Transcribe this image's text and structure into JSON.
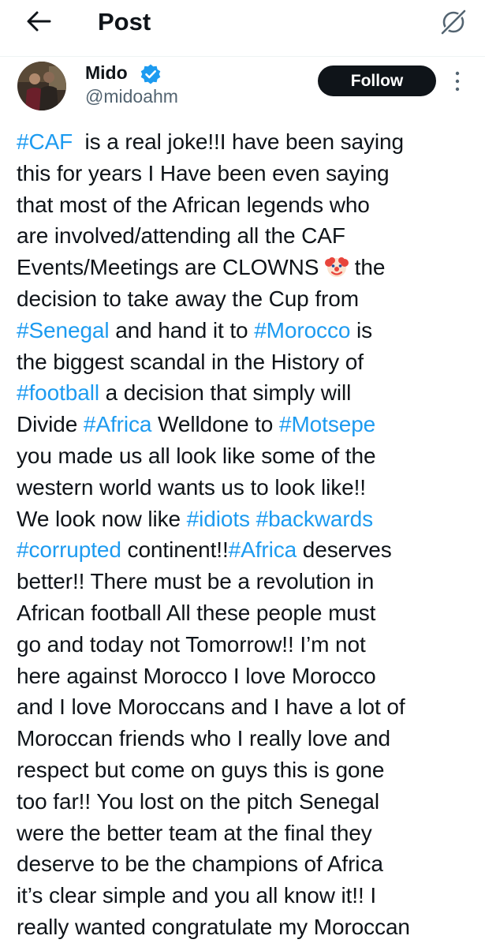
{
  "header": {
    "title": "Post",
    "back_icon": "arrow-left-icon",
    "grok_icon": "grok-icon"
  },
  "author": {
    "display_name": "Mido",
    "handle": "@midoahm",
    "verified": true,
    "verified_color": "#1d9bf0",
    "follow_label": "Follow"
  },
  "colors": {
    "hashtag": "#1d9bf0",
    "text": "#0f1419",
    "secondary": "#536471"
  },
  "post": {
    "emoji": "clown-face",
    "lines": [
      [
        {
          "t": "#CAF",
          "tag": true
        },
        {
          "t": "  is a real joke!!I have been saying"
        }
      ],
      [
        {
          "t": "this for years I Have been even saying"
        }
      ],
      [
        {
          "t": "that most of the African legends who"
        }
      ],
      [
        {
          "t": "are involved/attending all the CAF"
        }
      ],
      [
        {
          "t": "Events/Meetings are CLOWNS "
        },
        {
          "emoji": true
        },
        {
          "t": " the"
        }
      ],
      [
        {
          "t": "decision to take away the Cup from"
        }
      ],
      [
        {
          "t": "#Senegal",
          "tag": true
        },
        {
          "t": " and hand it to "
        },
        {
          "t": "#Morocco",
          "tag": true
        },
        {
          "t": " is"
        }
      ],
      [
        {
          "t": "the biggest scandal in the History of"
        }
      ],
      [
        {
          "t": "#football",
          "tag": true
        },
        {
          "t": " a decision that simply will"
        }
      ],
      [
        {
          "t": "Divide "
        },
        {
          "t": "#Africa",
          "tag": true
        },
        {
          "t": " Welldone to "
        },
        {
          "t": "#Motsepe",
          "tag": true
        }
      ],
      [
        {
          "t": "you made us all look like some of the"
        }
      ],
      [
        {
          "t": "western world wants us to look like!!"
        }
      ],
      [
        {
          "t": "We look now like "
        },
        {
          "t": "#idiots",
          "tag": true
        },
        {
          "t": " "
        },
        {
          "t": "#backwards",
          "tag": true
        }
      ],
      [
        {
          "t": "#corrupted",
          "tag": true
        },
        {
          "t": " continent!!"
        },
        {
          "t": "#Africa",
          "tag": true
        },
        {
          "t": " deserves"
        }
      ],
      [
        {
          "t": "better!! There must be a revolution in"
        }
      ],
      [
        {
          "t": "African football All these people must"
        }
      ],
      [
        {
          "t": "go and today not Tomorrow!! I’m not"
        }
      ],
      [
        {
          "t": "here against Morocco I love Morocco"
        }
      ],
      [
        {
          "t": "and I love Moroccans and I have a lot of"
        }
      ],
      [
        {
          "t": "Moroccan friends who I really love and"
        }
      ],
      [
        {
          "t": "respect but come on guys this is gone"
        }
      ],
      [
        {
          "t": "too far!! You lost on the pitch Senegal"
        }
      ],
      [
        {
          "t": "were the better team at the final they"
        }
      ],
      [
        {
          "t": "deserve to be the champions of Africa"
        }
      ],
      [
        {
          "t": "it’s clear simple and you all know it!! I"
        }
      ],
      [
        {
          "t": "really wanted congratulate my Moroccan"
        }
      ]
    ]
  }
}
